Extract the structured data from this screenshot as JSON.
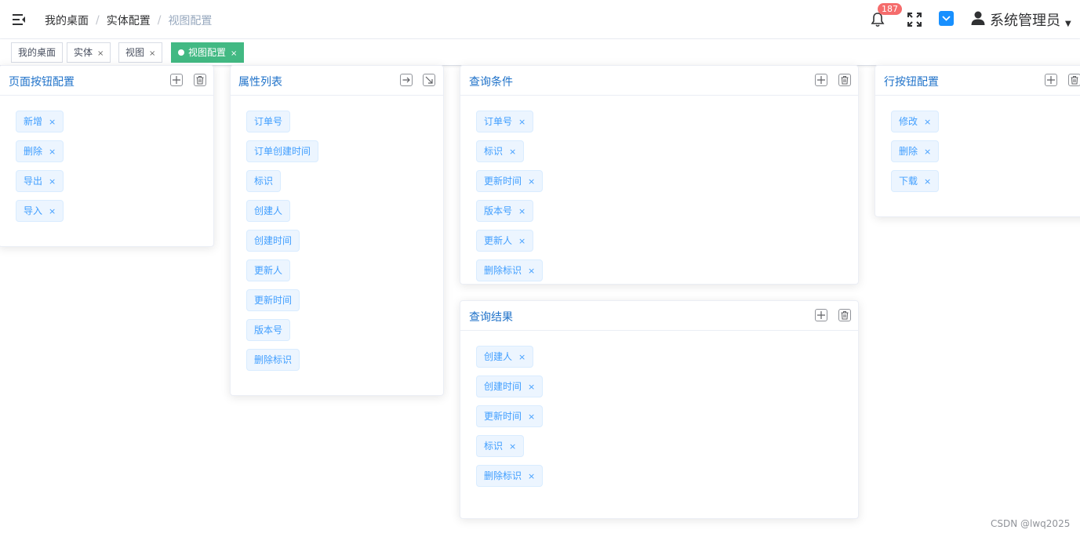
{
  "breadcrumb": [
    "我的桌面",
    "实体配置",
    "视图配置"
  ],
  "notifications": {
    "count": "187"
  },
  "user": {
    "name": "系统管理员"
  },
  "tabs": [
    {
      "label": "我的桌面",
      "closable": false,
      "active": false
    },
    {
      "label": "实体",
      "closable": true,
      "active": false
    },
    {
      "label": "视图",
      "closable": true,
      "active": false
    },
    {
      "label": "视图配置",
      "closable": true,
      "active": true
    }
  ],
  "panels": {
    "page_buttons": {
      "title": "页面按钮配置",
      "items": [
        "新增",
        "删除",
        "导出",
        "导入"
      ]
    },
    "attributes": {
      "title": "属性列表",
      "items": [
        "订单号",
        "订单创建时间",
        "标识",
        "创建人",
        "创建时间",
        "更新人",
        "更新时间",
        "版本号",
        "删除标识"
      ]
    },
    "query_conditions": {
      "title": "查询条件",
      "items": [
        "订单号",
        "标识",
        "更新时间",
        "版本号",
        "更新人",
        "删除标识"
      ]
    },
    "query_results": {
      "title": "查询结果",
      "items": [
        "创建人",
        "创建时间",
        "更新时间",
        "标识",
        "删除标识"
      ]
    },
    "row_buttons": {
      "title": "行按钮配置",
      "items": [
        "修改",
        "删除",
        "下载"
      ]
    }
  },
  "close_symbol": "×",
  "watermark": "CSDN @lwq2025",
  "colors": {
    "accent": "#1890ff",
    "active_tab": "#42b983",
    "chip_text": "#409eff",
    "chip_bg": "#ecf5ff",
    "badge": "#f56c6c"
  }
}
